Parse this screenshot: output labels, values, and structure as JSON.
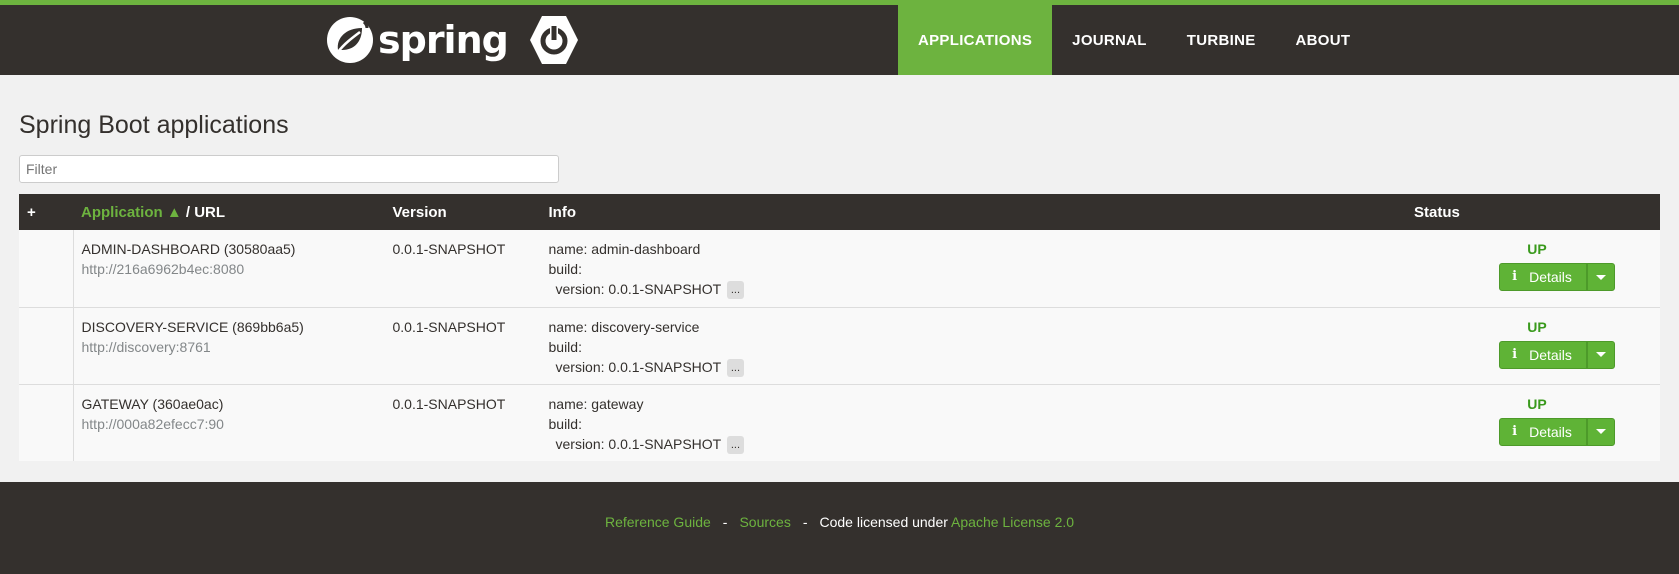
{
  "brand": {
    "wordmark": "spring"
  },
  "nav": {
    "items": [
      {
        "label": "APPLICATIONS",
        "active": true
      },
      {
        "label": "JOURNAL"
      },
      {
        "label": "TURBINE"
      },
      {
        "label": "ABOUT"
      }
    ]
  },
  "page": {
    "title": "Spring Boot applications"
  },
  "filter": {
    "placeholder": "Filter"
  },
  "table": {
    "headers": {
      "plus": "+",
      "application": "Application ▲",
      "url": " / URL",
      "version": "Version",
      "info": "Info",
      "status": "Status"
    },
    "rows": [
      {
        "name": "ADMIN-DASHBOARD (30580aa5)",
        "url": "http://216a6962b4ec:8080",
        "version": "0.0.1-SNAPSHOT",
        "info_name": "name: admin-dashboard",
        "info_build": "build:",
        "info_version": "version: 0.0.1-SNAPSHOT",
        "ellipsis": "...",
        "status": "UP",
        "details_label": "Details"
      },
      {
        "name": "DISCOVERY-SERVICE (869bb6a5)",
        "url": "http://discovery:8761",
        "version": "0.0.1-SNAPSHOT",
        "info_name": "name: discovery-service",
        "info_build": "build:",
        "info_version": "version: 0.0.1-SNAPSHOT",
        "ellipsis": "...",
        "status": "UP",
        "details_label": "Details"
      },
      {
        "name": "GATEWAY (360ae0ac)",
        "url": "http://000a82efecc7:90",
        "version": "0.0.1-SNAPSHOT",
        "info_name": "name: gateway",
        "info_build": "build:",
        "info_version": "version: 0.0.1-SNAPSHOT",
        "ellipsis": "...",
        "status": "UP",
        "details_label": "Details"
      }
    ]
  },
  "footer": {
    "reference_guide": "Reference Guide",
    "sources": "Sources",
    "sep": "-",
    "license_text": "Code licensed under",
    "license_link": "Apache License 2.0"
  },
  "colors": {
    "brand_green": "#6db33f",
    "dark": "#34302d",
    "status_up": "#3a9a1d"
  },
  "icons": [
    "spring-leaf-icon",
    "power-icon",
    "info-icon",
    "caret-down-icon"
  ]
}
